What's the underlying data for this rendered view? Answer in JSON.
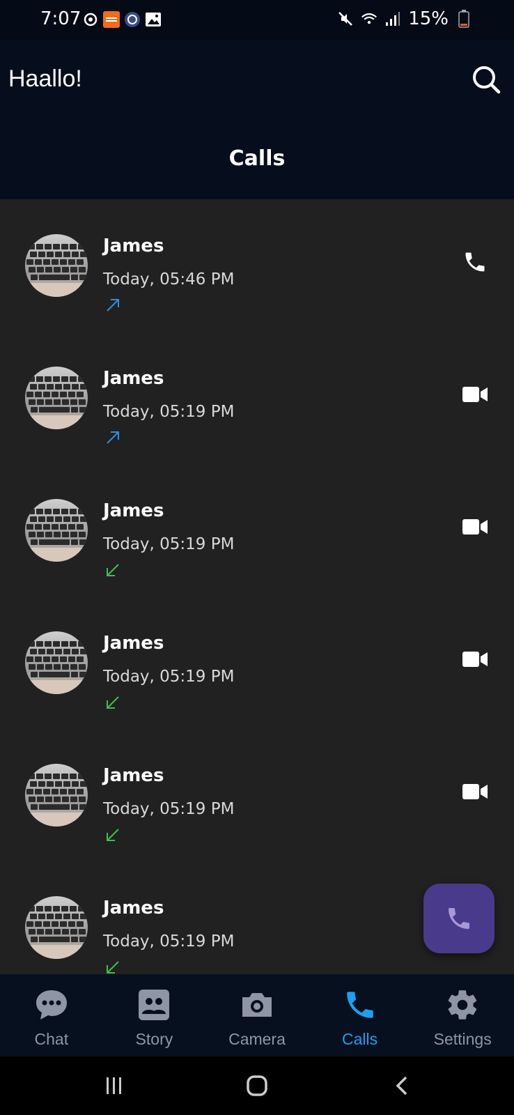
{
  "status_bar": {
    "time": "7:07",
    "battery": "15%",
    "icons_left": [
      "sync-icon",
      "temu-icon",
      "chat-app-icon",
      "gallery-icon"
    ],
    "icons_right": [
      "mute-icon",
      "wifi-icon",
      "signal-icon",
      "battery-icon"
    ]
  },
  "header": {
    "app_name": "Haallo!",
    "title": "Calls"
  },
  "calls": [
    {
      "name": "James",
      "time": "Today, 05:46 PM",
      "direction": "outgoing",
      "type": "voice"
    },
    {
      "name": "James",
      "time": "Today, 05:19 PM",
      "direction": "outgoing",
      "type": "video"
    },
    {
      "name": "James",
      "time": "Today, 05:19 PM",
      "direction": "incoming",
      "type": "video"
    },
    {
      "name": "James",
      "time": "Today, 05:19 PM",
      "direction": "incoming",
      "type": "video"
    },
    {
      "name": "James",
      "time": "Today, 05:19 PM",
      "direction": "incoming",
      "type": "video"
    },
    {
      "name": "James",
      "time": "Today, 05:19 PM",
      "direction": "incoming",
      "type": "voice"
    }
  ],
  "nav": {
    "items": [
      {
        "label": "Chat",
        "icon": "chat-bubble-icon"
      },
      {
        "label": "Story",
        "icon": "story-icon"
      },
      {
        "label": "Camera",
        "icon": "camera-icon"
      },
      {
        "label": "Calls",
        "icon": "phone-icon"
      },
      {
        "label": "Settings",
        "icon": "gear-icon"
      }
    ],
    "active": "Calls"
  },
  "colors": {
    "outgoing": "#2d8fe0",
    "incoming": "#3fbf4a",
    "accent": "#1aa0f0",
    "fab": "#4a3a8c"
  }
}
